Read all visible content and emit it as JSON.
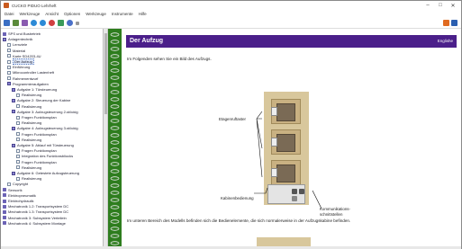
{
  "window": {
    "title": "CUCKO PIDUO Lehrheft",
    "controls": [
      "–",
      "□",
      "✕"
    ]
  },
  "menu": [
    "Datei",
    "Werkzeuge",
    "Ansicht",
    "Optionen",
    "Werkzeuge",
    "Instrumente",
    "Hilfe"
  ],
  "toolbar": {
    "icons": [
      "save-icon",
      "print-icon",
      "book-icon",
      "back-icon",
      "forward-icon",
      "stop-icon",
      "home-icon",
      "help-icon",
      "dropdown-icon"
    ]
  },
  "tree": [
    {
      "label": "SPS und Busbetrieb",
      "icon": "book",
      "level": 0
    },
    {
      "label": "Anlagentechnik",
      "icon": "book-open",
      "level": 0
    },
    {
      "label": "Lernziele",
      "icon": "page",
      "level": 1
    },
    {
      "label": "Material",
      "icon": "page",
      "level": 1
    },
    {
      "label": "Karte SD4203-4U",
      "icon": "page",
      "level": 1
    },
    {
      "label": "Der Aufzug",
      "icon": "page",
      "level": 1,
      "selected": true
    },
    {
      "label": "Einführung",
      "icon": "page",
      "level": 1
    },
    {
      "label": "Mikrocontroller Lastenheft",
      "icon": "page",
      "level": 1
    },
    {
      "label": "Rahmenentwurf",
      "icon": "page",
      "level": 1
    },
    {
      "label": "Programmieraufgaben",
      "icon": "book-open",
      "level": 1
    },
    {
      "label": "Aufgabe 1: Türsteuerung",
      "icon": "book-open",
      "level": 2
    },
    {
      "label": "Realisierung",
      "icon": "page",
      "level": 3
    },
    {
      "label": "Aufgabe 2: Steuerung der Kabine",
      "icon": "book-open",
      "level": 2
    },
    {
      "label": "Realisierung",
      "icon": "page",
      "level": 3
    },
    {
      "label": "Aufgabe 3: Aufzugsteuerung 2-stöckig",
      "icon": "book-open",
      "level": 2
    },
    {
      "label": "Fragen Funktionsplan",
      "icon": "page",
      "level": 3
    },
    {
      "label": "Realisierung",
      "icon": "page",
      "level": 3
    },
    {
      "label": "Aufgabe 4: Aufzugsteuerung 3-stöckig",
      "icon": "book-open",
      "level": 2
    },
    {
      "label": "Fragen Funktionsplan",
      "icon": "page",
      "level": 3
    },
    {
      "label": "Realisierung",
      "icon": "page",
      "level": 3
    },
    {
      "label": "Aufgabe 5: Ablauf mit Türsteuerung",
      "icon": "book-open",
      "level": 2
    },
    {
      "label": "Fragen Funktionsplan",
      "icon": "page",
      "level": 3
    },
    {
      "label": "Integration des Funktionsbliocks",
      "icon": "page",
      "level": 3
    },
    {
      "label": "Fragen Funktionsplan",
      "icon": "page",
      "level": 3
    },
    {
      "label": "Realisierung",
      "icon": "page",
      "level": 3
    },
    {
      "label": "Aufgabe 6: Getestete Aufzugsteuerung",
      "icon": "book-open",
      "level": 2
    },
    {
      "label": "Realisierung",
      "icon": "page",
      "level": 3
    },
    {
      "label": "Copyright",
      "icon": "page",
      "level": 1
    },
    {
      "label": "Sensorik",
      "icon": "book",
      "level": 0
    },
    {
      "label": "Elektropneumatik",
      "icon": "book",
      "level": 0
    },
    {
      "label": "Elektrohydraulik",
      "icon": "book",
      "level": 0
    },
    {
      "label": "Mechatronik 1.2: Transportsystem DC",
      "icon": "book",
      "level": 0
    },
    {
      "label": "Mechatronik 1.3: Transportsystem DC",
      "icon": "book",
      "level": 0
    },
    {
      "label": "Mechatronik 3: Subsystem Verteileln",
      "icon": "book",
      "level": 0
    },
    {
      "label": "Mechatronik 4: Subsystem Montage",
      "icon": "book",
      "level": 0
    }
  ],
  "content": {
    "title": "Der Aufzug",
    "banner_right": "Englishe",
    "intro": "Im Folgenden sehen Sie ein Bild des Aufzugs.",
    "outro": "Im unteren Bereich des Modells befinden sich die Bedienelemente, die sich normalerweise in der Aufzugskabine befinden.",
    "labels": {
      "floor_buttons": "Etagenruftaster",
      "cabin_control": "Kabinenbedienung",
      "comm_line1": "Kommunikations-",
      "comm_line2": "schnittstellen"
    }
  },
  "colors": {
    "banner": "#4b1f8a",
    "binding": "#2e7d1e",
    "accent": "#c85a1e"
  }
}
